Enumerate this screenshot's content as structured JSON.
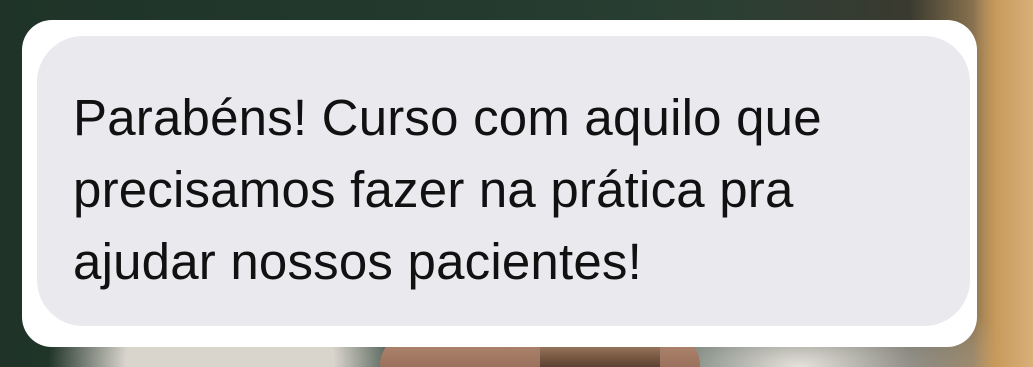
{
  "message": {
    "lines": [
      "Parabéns! Curso com aquilo que",
      "precisamos fazer na prática pra",
      "ajudar nossos pacientes!"
    ]
  }
}
